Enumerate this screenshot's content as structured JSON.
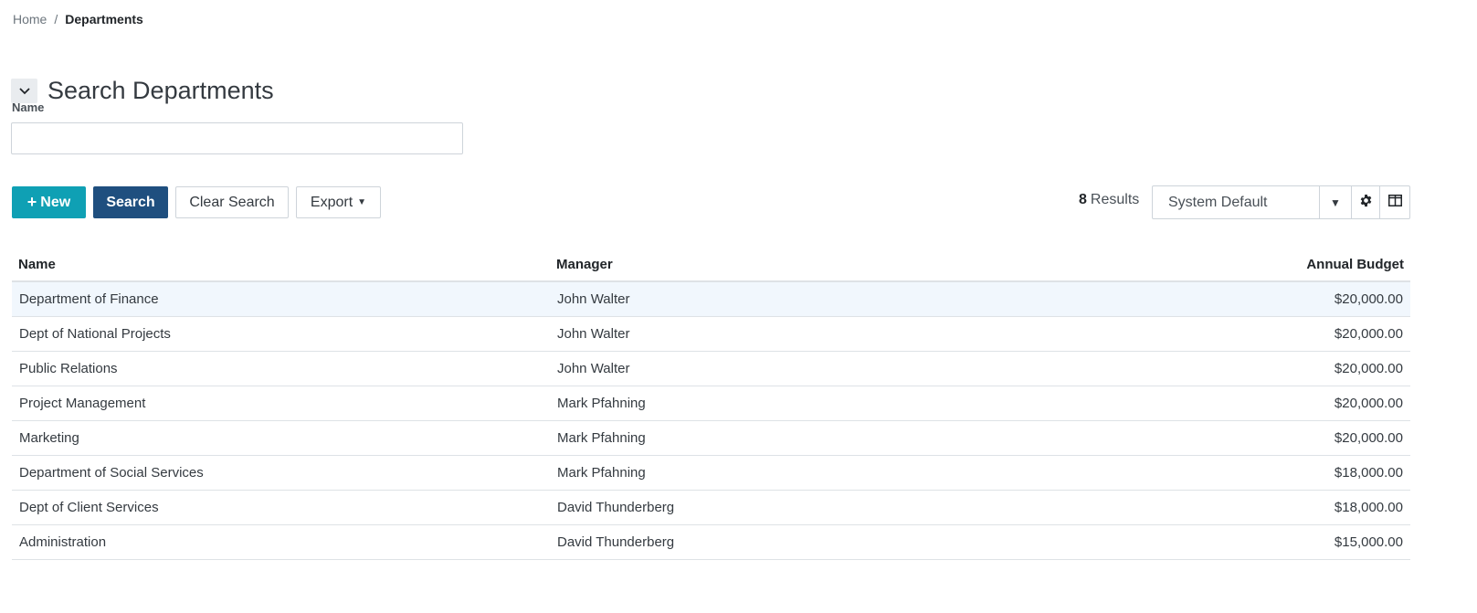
{
  "breadcrumb": {
    "home": "Home",
    "separator": "/",
    "current": "Departments"
  },
  "search_panel": {
    "toggle_icon": "chevron-down-icon",
    "title": "Search Departments",
    "name_label": "Name",
    "name_value": "",
    "name_placeholder": ""
  },
  "toolbar": {
    "new_label": "New",
    "new_icon": "plus-icon",
    "search_label": "Search",
    "clear_label": "Clear Search",
    "export_label": "Export",
    "results_count": "8",
    "results_label": "Results",
    "view_selected": "System Default",
    "settings_icon": "gear-icon",
    "columns_icon": "columns-icon"
  },
  "colors": {
    "new_button": "#0fa0b4",
    "search_button": "#1f4f7f",
    "row_highlight": "#f1f7fd"
  },
  "table": {
    "columns": [
      "Name",
      "Manager",
      "Annual Budget"
    ],
    "rows": [
      {
        "name": "Department of Finance",
        "manager": "John Walter",
        "budget": "$20,000.00"
      },
      {
        "name": "Dept of National Projects",
        "manager": "John Walter",
        "budget": "$20,000.00"
      },
      {
        "name": "Public Relations",
        "manager": "John Walter",
        "budget": "$20,000.00"
      },
      {
        "name": "Project Management",
        "manager": "Mark Pfahning",
        "budget": "$20,000.00"
      },
      {
        "name": "Marketing",
        "manager": "Mark Pfahning",
        "budget": "$20,000.00"
      },
      {
        "name": "Department of Social Services",
        "manager": "Mark Pfahning",
        "budget": "$18,000.00"
      },
      {
        "name": "Dept of Client Services",
        "manager": "David Thunderberg",
        "budget": "$18,000.00"
      },
      {
        "name": "Administration",
        "manager": "David Thunderberg",
        "budget": "$15,000.00"
      }
    ]
  }
}
